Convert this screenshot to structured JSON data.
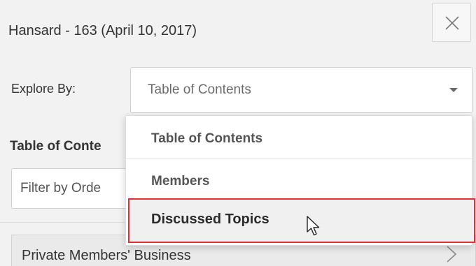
{
  "header": {
    "title": "Hansard - 163 (April 10, 2017)",
    "close_icon": "close-icon"
  },
  "explore": {
    "label": "Explore By:",
    "selected": "Table of Contents",
    "caret_icon": "chevron-down-icon",
    "options": [
      {
        "label": "Table of Contents"
      },
      {
        "label": "Members"
      },
      {
        "label": "Discussed Topics",
        "hovered": true
      }
    ]
  },
  "toc": {
    "heading": "Table of Conte",
    "filter_placeholder": "Filter by Orde"
  },
  "list": {
    "items": [
      {
        "label": "Private Members' Business",
        "icon": "chevron-right-icon"
      }
    ]
  },
  "colors": {
    "panel_bg": "#f2f2f2",
    "highlight_border": "#e0303a",
    "text": "#333333"
  }
}
